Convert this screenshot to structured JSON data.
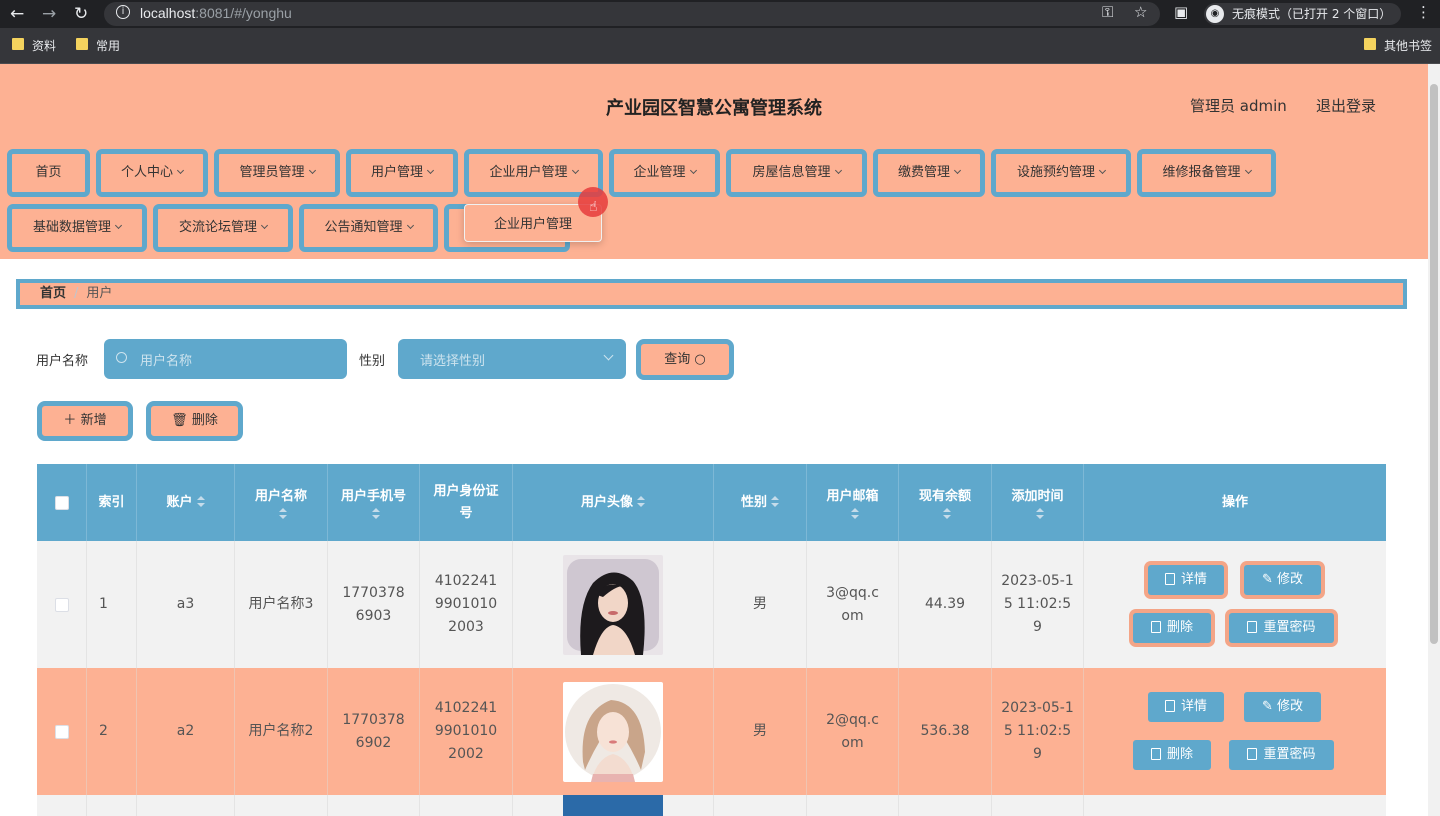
{
  "browser": {
    "url_host": "localhost",
    "url_rest": ":8081/#/yonghu",
    "incognito_label": "无痕模式（已打开 2 个窗口）",
    "bookmarks": [
      "资料",
      "常用"
    ],
    "other_bookmarks": "其他书签"
  },
  "header": {
    "title": "产业园区智慧公寓管理系统",
    "user": "管理员 admin",
    "logout": "退出登录"
  },
  "menu": {
    "row1": [
      "首页",
      "个人中心",
      "管理员管理",
      "用户管理",
      "企业用户管理",
      "企业管理",
      "房屋信息管理",
      "缴费管理",
      "设施预约管理",
      "维修报备管理"
    ],
    "row2": [
      "基础数据管理",
      "交流论坛管理",
      "公告通知管理"
    ],
    "dropdown_item": "企业用户管理"
  },
  "breadcrumb": {
    "home": "首页",
    "current": "用户"
  },
  "search": {
    "name_label": "用户名称",
    "name_placeholder": "用户名称",
    "gender_label": "性别",
    "gender_placeholder": "请选择性别",
    "query_button": "查询"
  },
  "actions": {
    "add": "新增",
    "delete": "删除"
  },
  "table": {
    "headers": {
      "index": "索引",
      "account": "账户",
      "name": "用户名称",
      "phone": "用户手机号",
      "idcard": "用户身份证号",
      "avatar": "用户头像",
      "gender": "性别",
      "email": "用户邮箱",
      "balance": "现有余额",
      "time": "添加时间",
      "ops": "操作"
    },
    "row_buttons": {
      "detail": "详情",
      "edit": "修改",
      "delete": "删除",
      "reset": "重置密码"
    },
    "rows": [
      {
        "index": "1",
        "account": "a3",
        "name": "用户名称3",
        "phone": "17703786903",
        "idcard": "410224199010102003",
        "gender": "男",
        "email": "3@qq.com",
        "balance": "44.39",
        "time": "2023-05-15 11:02:59"
      },
      {
        "index": "2",
        "account": "a2",
        "name": "用户名称2",
        "phone": "17703786902",
        "idcard": "410224199010102002",
        "gender": "男",
        "email": "2@qq.com",
        "balance": "536.38",
        "time": "2023-05-15 11:02:59"
      }
    ]
  },
  "colors": {
    "accent": "#5fa8cc",
    "salmon": "#fdb193",
    "row_alt": "#f2f2f2"
  }
}
